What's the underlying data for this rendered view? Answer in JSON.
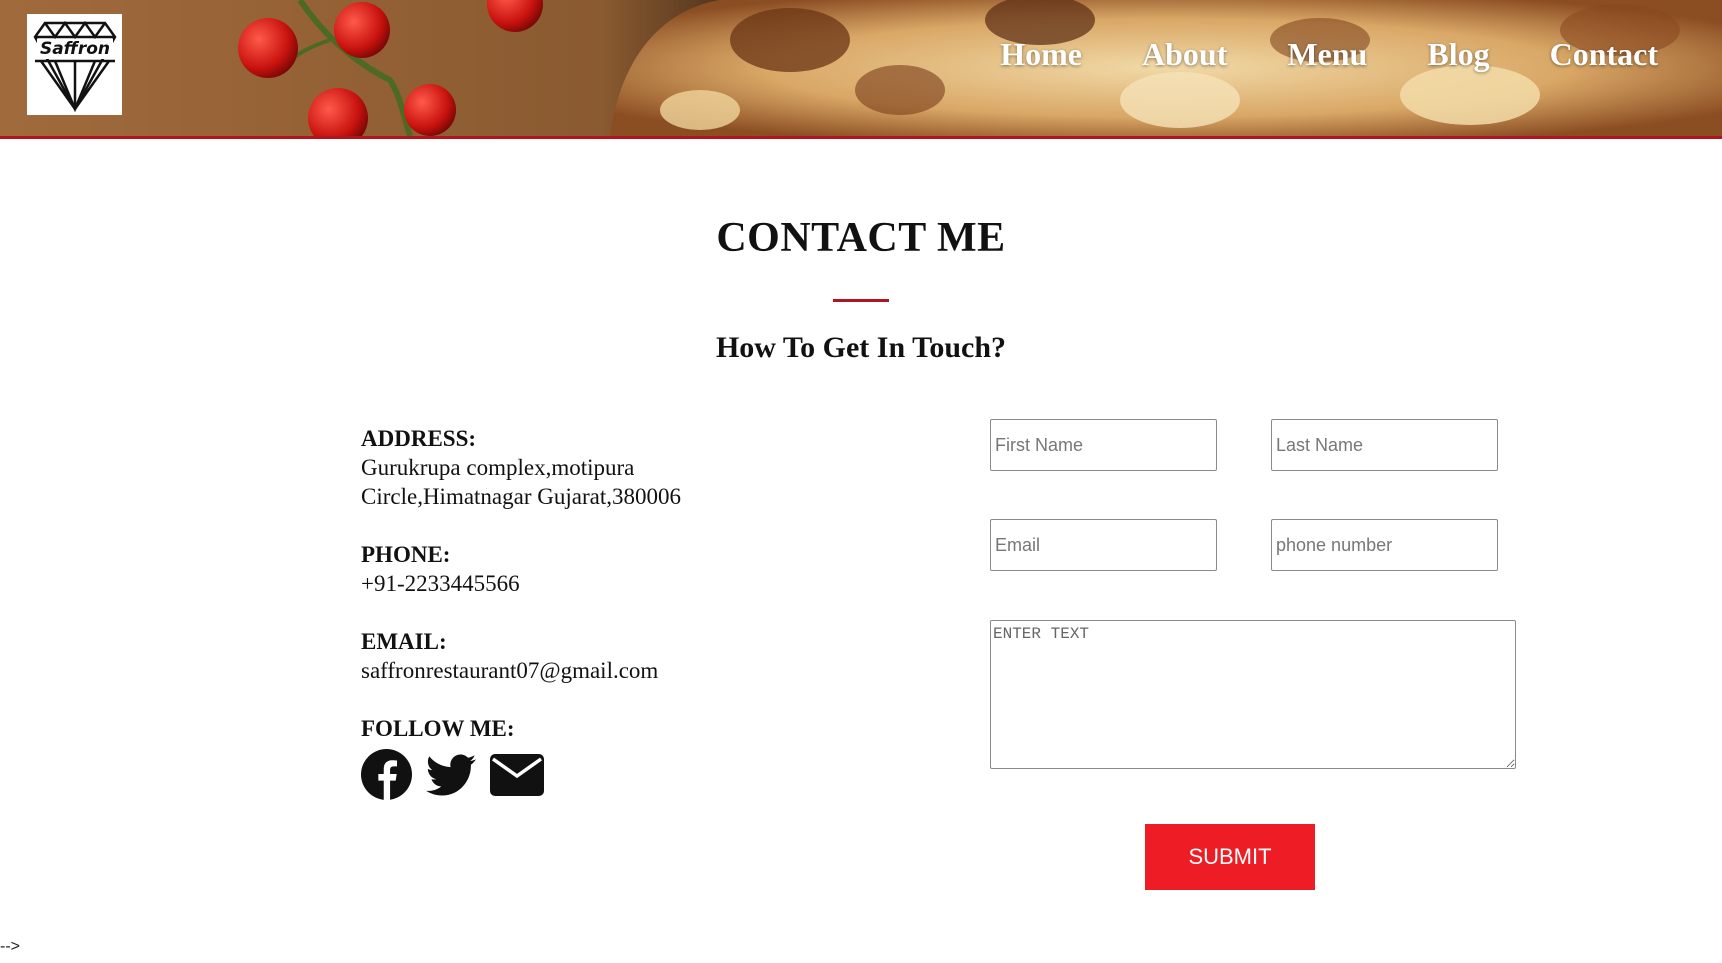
{
  "header": {
    "logo_text": "Saffron",
    "nav": [
      {
        "label": "Home"
      },
      {
        "label": "About"
      },
      {
        "label": "Menu"
      },
      {
        "label": "Blog"
      },
      {
        "label": "Contact"
      }
    ],
    "accent_color": "#b3141f"
  },
  "main": {
    "title": "CONTACT ME",
    "subtitle": "How To Get In Touch?"
  },
  "contact": {
    "address_label": "ADDRESS:",
    "address_line1": "Gurukrupa complex,motipura",
    "address_line2": "Circle,Himatnagar Gujarat,380006",
    "phone_label": "PHONE:",
    "phone_value": "+91-2233445566",
    "email_label": "EMAIL:",
    "email_value": "saffronrestaurant07@gmail.com",
    "follow_label": "FOLLOW ME:",
    "social_icons": [
      "facebook-icon",
      "twitter-icon",
      "mail-icon"
    ]
  },
  "form": {
    "first_name": {
      "placeholder": "First Name",
      "value": ""
    },
    "last_name": {
      "placeholder": "Last Name",
      "value": ""
    },
    "email": {
      "placeholder": "Email",
      "value": ""
    },
    "phone": {
      "placeholder": "phone number",
      "value": ""
    },
    "message": {
      "placeholder": "ENTER TEXT",
      "value": ""
    },
    "submit_label": "SUBMIT",
    "submit_color": "#ee1c24"
  },
  "footer": {
    "stray_text": "-->"
  }
}
